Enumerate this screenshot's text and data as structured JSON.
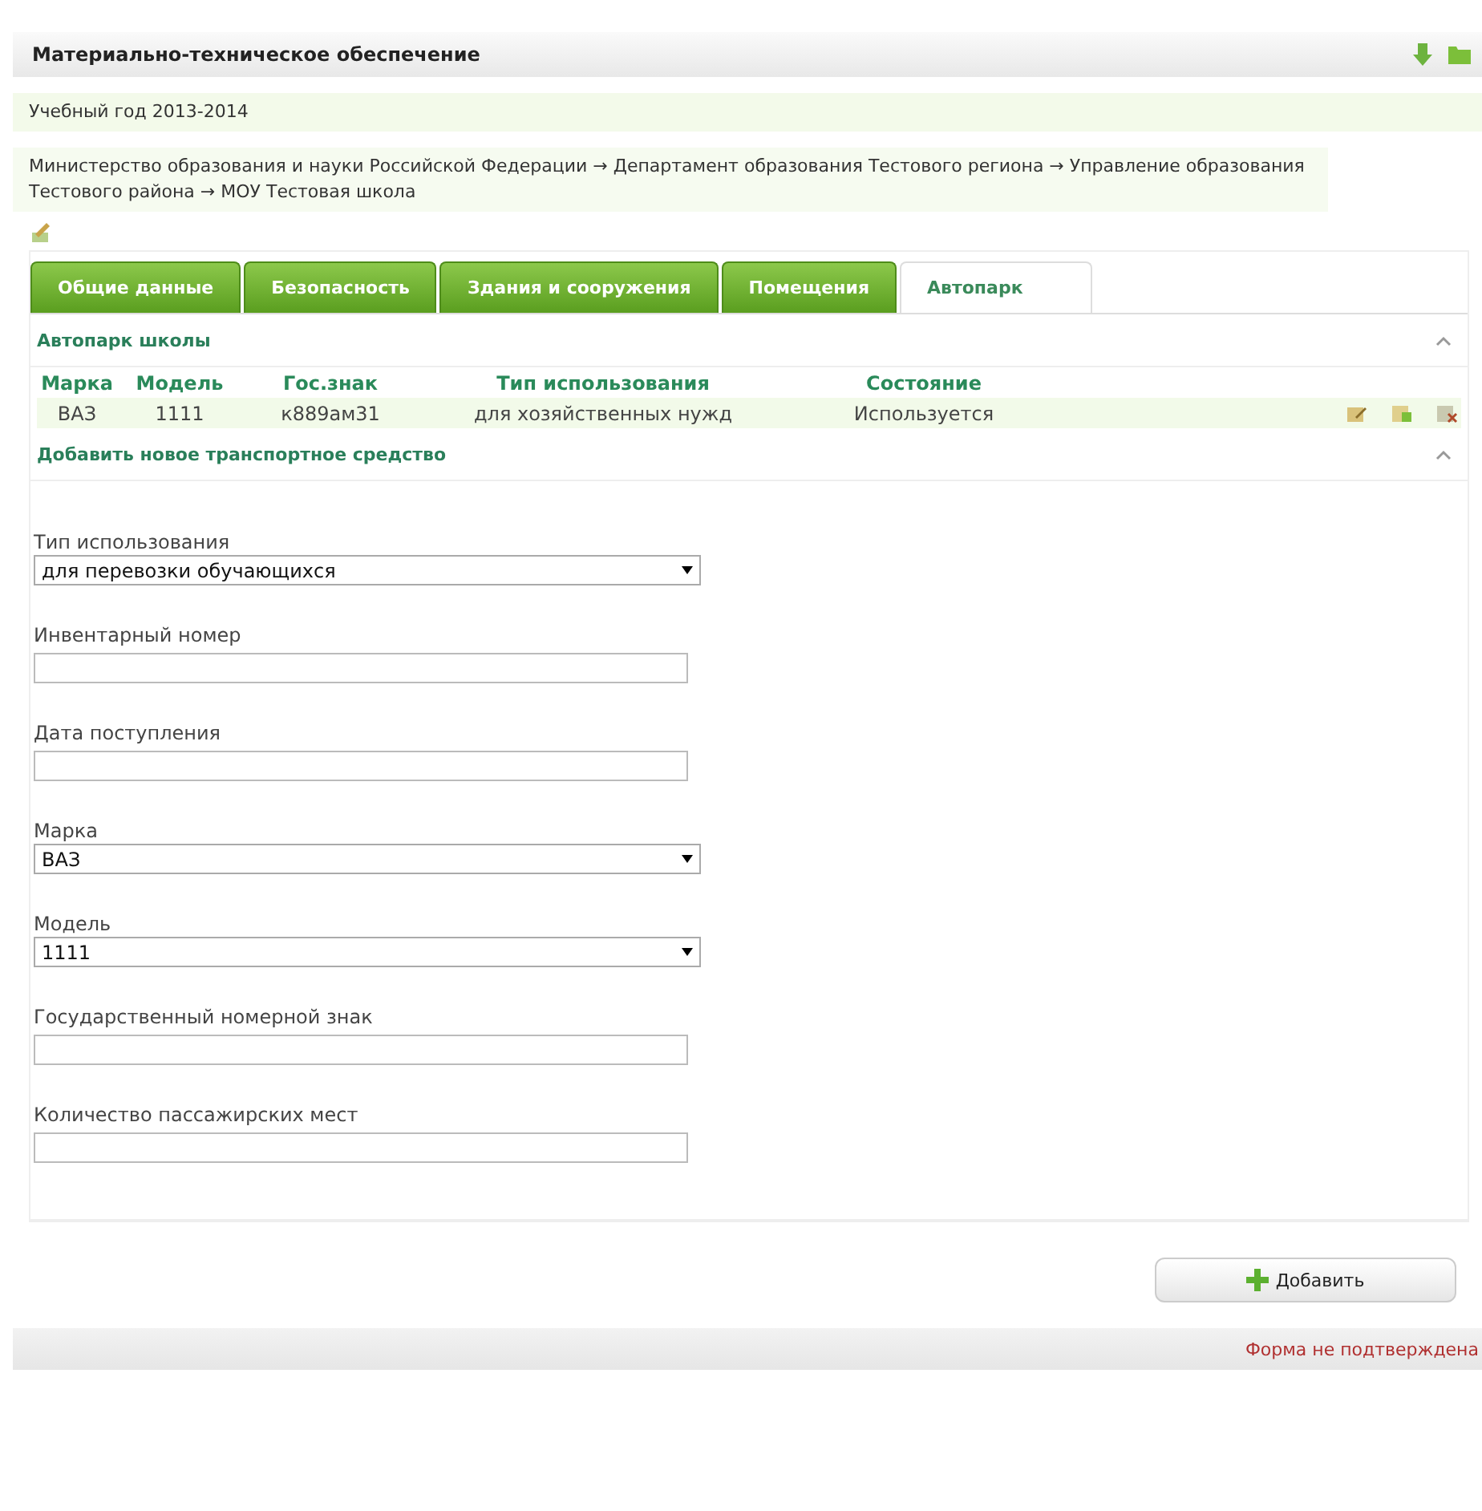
{
  "header": {
    "title": "Материально-техническое обеспечение"
  },
  "year": "Учебный год 2013-2014",
  "breadcrumb": "Министерство образования и науки Российской Федерации → Департамент образования Тестового региона → Управление образования Тестового района → МОУ Тестовая школа",
  "tabs": [
    {
      "label": "Общие данные",
      "selected": false
    },
    {
      "label": "Безопасность",
      "selected": false
    },
    {
      "label": "Здания и сооружения",
      "selected": false
    },
    {
      "label": "Помещения",
      "selected": false
    },
    {
      "label": "Автопарк",
      "selected": true
    }
  ],
  "fleet": {
    "title": "Автопарк школы",
    "columns": [
      "Марка",
      "Модель",
      "Гос.знак",
      "Тип использования",
      "Состояние"
    ],
    "rows": [
      {
        "cells": [
          "ВАЗ",
          "1111",
          "к889ам31",
          "для хозяйственных нужд",
          "Используется"
        ]
      }
    ]
  },
  "form": {
    "title": "Добавить новое транспортное средство",
    "fields": [
      {
        "kind": "select",
        "label": "Тип использования",
        "value": "для перевозки обучающихся"
      },
      {
        "kind": "input",
        "label": "Инвентарный номер"
      },
      {
        "kind": "input",
        "label": "Дата поступления"
      },
      {
        "kind": "select",
        "label": "Марка",
        "value": "ВАЗ"
      },
      {
        "kind": "select",
        "label": "Модель",
        "value": "1111"
      },
      {
        "kind": "input",
        "label": "Государственный номерной знак"
      },
      {
        "kind": "input",
        "label": "Количество пассажирских мест"
      }
    ],
    "button": "Добавить"
  },
  "status": "Форма не подтверждена"
}
